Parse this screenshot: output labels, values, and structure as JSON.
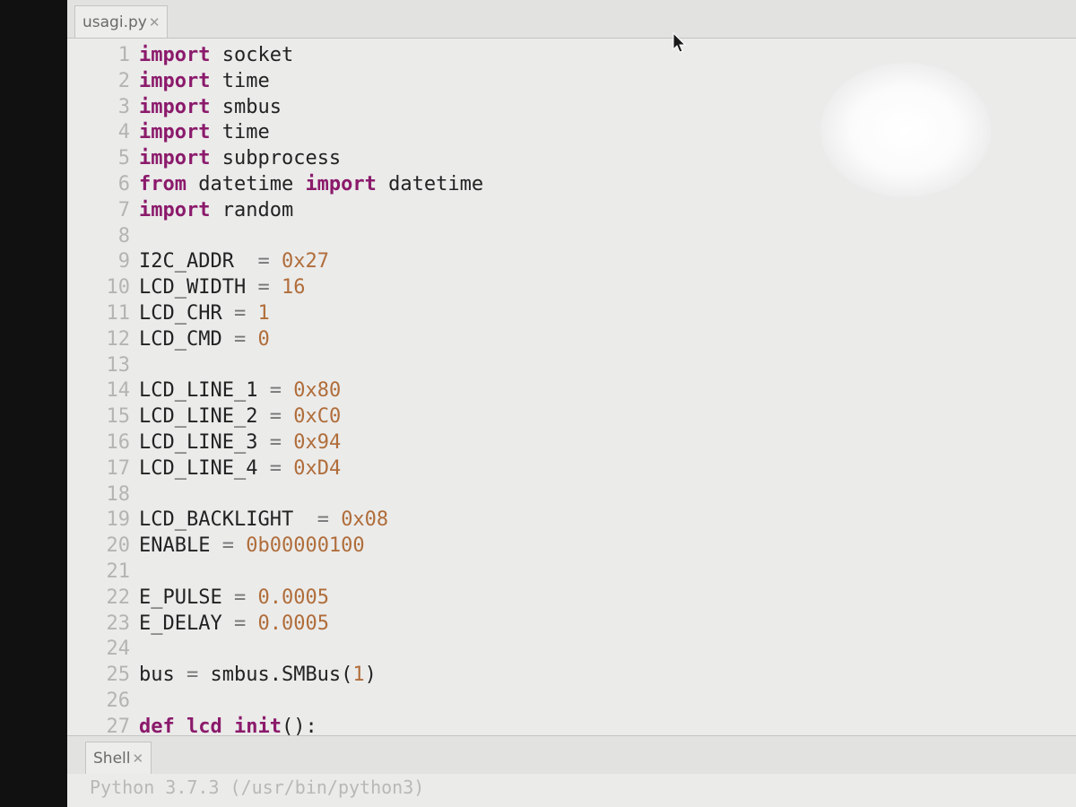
{
  "editor": {
    "tab_label": "usagi.py",
    "tab_close": "✕",
    "line_numbers": [
      "1",
      "2",
      "3",
      "4",
      "5",
      "6",
      "7",
      "8",
      "9",
      "10",
      "11",
      "12",
      "13",
      "14",
      "15",
      "16",
      "17",
      "18",
      "19",
      "20",
      "21",
      "22",
      "23",
      "24",
      "25",
      "26",
      "27"
    ],
    "lines": [
      [
        {
          "t": "import",
          "c": "kw"
        },
        {
          "t": " socket"
        }
      ],
      [
        {
          "t": "import",
          "c": "kw"
        },
        {
          "t": " time"
        }
      ],
      [
        {
          "t": "import",
          "c": "kw"
        },
        {
          "t": " smbus"
        }
      ],
      [
        {
          "t": "import",
          "c": "kw"
        },
        {
          "t": " time"
        }
      ],
      [
        {
          "t": "import",
          "c": "kw"
        },
        {
          "t": " subprocess"
        }
      ],
      [
        {
          "t": "from",
          "c": "kw"
        },
        {
          "t": " datetime "
        },
        {
          "t": "import",
          "c": "kw"
        },
        {
          "t": " datetime"
        }
      ],
      [
        {
          "t": "import",
          "c": "kw"
        },
        {
          "t": " random"
        }
      ],
      [],
      [
        {
          "t": "I2C_ADDR  "
        },
        {
          "t": "=",
          "c": "op"
        },
        {
          "t": " "
        },
        {
          "t": "0x27",
          "c": "num"
        }
      ],
      [
        {
          "t": "LCD_WIDTH "
        },
        {
          "t": "=",
          "c": "op"
        },
        {
          "t": " "
        },
        {
          "t": "16",
          "c": "num"
        }
      ],
      [
        {
          "t": "LCD_CHR "
        },
        {
          "t": "=",
          "c": "op"
        },
        {
          "t": " "
        },
        {
          "t": "1",
          "c": "num"
        }
      ],
      [
        {
          "t": "LCD_CMD "
        },
        {
          "t": "=",
          "c": "op"
        },
        {
          "t": " "
        },
        {
          "t": "0",
          "c": "num"
        }
      ],
      [],
      [
        {
          "t": "LCD_LINE_1 "
        },
        {
          "t": "=",
          "c": "op"
        },
        {
          "t": " "
        },
        {
          "t": "0x80",
          "c": "num"
        }
      ],
      [
        {
          "t": "LCD_LINE_2 "
        },
        {
          "t": "=",
          "c": "op"
        },
        {
          "t": " "
        },
        {
          "t": "0xC0",
          "c": "num"
        }
      ],
      [
        {
          "t": "LCD_LINE_3 "
        },
        {
          "t": "=",
          "c": "op"
        },
        {
          "t": " "
        },
        {
          "t": "0x94",
          "c": "num"
        }
      ],
      [
        {
          "t": "LCD_LINE_4 "
        },
        {
          "t": "=",
          "c": "op"
        },
        {
          "t": " "
        },
        {
          "t": "0xD4",
          "c": "num"
        }
      ],
      [],
      [
        {
          "t": "LCD_BACKLIGHT  "
        },
        {
          "t": "=",
          "c": "op"
        },
        {
          "t": " "
        },
        {
          "t": "0x08",
          "c": "num"
        }
      ],
      [
        {
          "t": "ENABLE "
        },
        {
          "t": "=",
          "c": "op"
        },
        {
          "t": " "
        },
        {
          "t": "0b00000100",
          "c": "num"
        }
      ],
      [],
      [
        {
          "t": "E_PULSE "
        },
        {
          "t": "=",
          "c": "op"
        },
        {
          "t": " "
        },
        {
          "t": "0.0005",
          "c": "num"
        }
      ],
      [
        {
          "t": "E_DELAY "
        },
        {
          "t": "=",
          "c": "op"
        },
        {
          "t": " "
        },
        {
          "t": "0.0005",
          "c": "num"
        }
      ],
      [],
      [
        {
          "t": "bus "
        },
        {
          "t": "=",
          "c": "op"
        },
        {
          "t": " smbus.SMBus("
        },
        {
          "t": "1",
          "c": "num"
        },
        {
          "t": ")"
        }
      ],
      [],
      [
        {
          "t": "def",
          "c": "kw"
        },
        {
          "t": " "
        },
        {
          "t": "lcd_init",
          "c": "fn"
        },
        {
          "t": "():"
        }
      ]
    ]
  },
  "shell": {
    "tab_label": "Shell",
    "tab_close": "✕",
    "output": "Python 3.7.3 (/usr/bin/python3)"
  },
  "icons": {
    "mouse_cursor": "mouse-pointer-icon",
    "tab_close": "close-icon"
  },
  "colors": {
    "keyword": "#8b1a6b",
    "number": "#b06d3a",
    "line_number": "#b4b4b2",
    "editor_bg": "#ebebea"
  }
}
